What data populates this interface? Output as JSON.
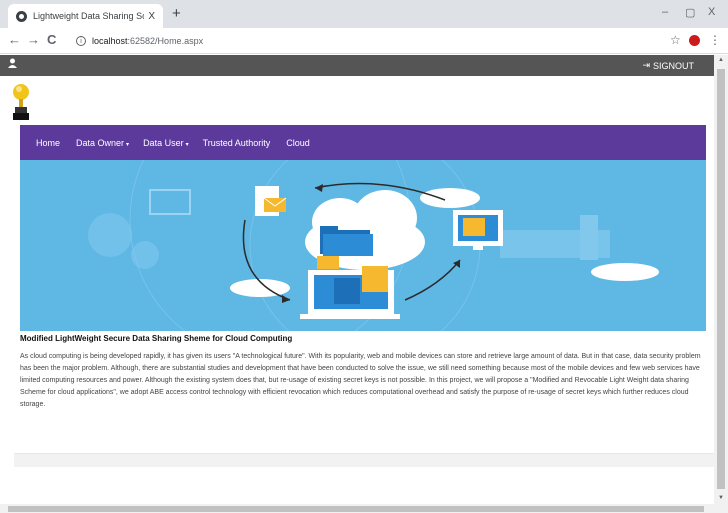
{
  "browser": {
    "tab_title": "Lightweight Data Sharing Scheme",
    "tab_close": "X",
    "new_tab": "+",
    "url_host": "localhost",
    "url_rest": ":62582/Home.aspx",
    "window_controls": {
      "minimize": "–",
      "restore": "▢",
      "close": "X"
    }
  },
  "topbar": {
    "signout_label": "SIGNOUT"
  },
  "nav": {
    "items": [
      {
        "label": "Home",
        "caret": ""
      },
      {
        "label": "Data Owner",
        "caret": "▾"
      },
      {
        "label": "Data User",
        "caret": "▾"
      },
      {
        "label": "Trusted Authority",
        "caret": ""
      },
      {
        "label": "Cloud",
        "caret": ""
      }
    ]
  },
  "content": {
    "headline": "Modified LightWeight Secure Data Sharing Sheme for Cloud Computing",
    "description": "As cloud computing is being developed rapidly, it has given its users \"A technological future\". With its popularity, web and mobile devices can store and retrieve large amount of data. But in that case, data security problem has been the major problem. Although, there are substantial studies and development that have been conducted to solve the issue, we still need something because most of the mobile devices and few web services have limited computing resources and power. Although the existing system does that, but re-usage of existing secret keys is not possible. In this project, we will propose a \"Modified and Revocable Light Weight data sharing Scheme for cloud applications\", we adopt ABE access control technology with efficient revocation which reduces computational overhead and satisfy the purpose of re-usage of secret keys which further reduces cloud storage."
  },
  "colors": {
    "topbar": "#555555",
    "navbar": "#5c3a9c",
    "banner": "#5fb7e4"
  },
  "icons": {
    "user": "user-icon",
    "signout": "signout-icon",
    "logo": "trophy-logo-icon",
    "banner": "cloud-file-sharing-illustration"
  }
}
